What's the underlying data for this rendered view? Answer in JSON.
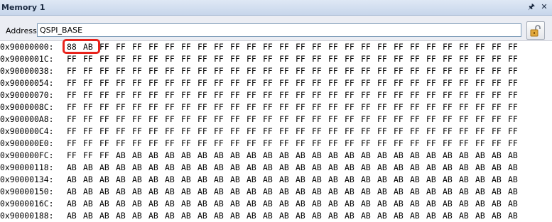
{
  "window": {
    "title": "Memory 1",
    "pin_icon": "pin-icon",
    "close_icon": "close-icon"
  },
  "toolbar": {
    "address_label": "Address:",
    "address_value": "QSPI_BASE",
    "lock_icon": "unlock-icon"
  },
  "memory": {
    "rows": [
      {
        "addr": "0x90000000:",
        "bytes": [
          "88",
          "AB",
          "FF",
          "FF",
          "FF",
          "FF",
          "FF",
          "FF",
          "FF",
          "FF",
          "FF",
          "FF",
          "FF",
          "FF",
          "FF",
          "FF",
          "FF",
          "FF",
          "FF",
          "FF",
          "FF",
          "FF",
          "FF",
          "FF",
          "FF",
          "FF",
          "FF",
          "FF"
        ]
      },
      {
        "addr": "0x9000001C:",
        "bytes": [
          "FF",
          "FF",
          "FF",
          "FF",
          "FF",
          "FF",
          "FF",
          "FF",
          "FF",
          "FF",
          "FF",
          "FF",
          "FF",
          "FF",
          "FF",
          "FF",
          "FF",
          "FF",
          "FF",
          "FF",
          "FF",
          "FF",
          "FF",
          "FF",
          "FF",
          "FF",
          "FF",
          "FF"
        ]
      },
      {
        "addr": "0x90000038:",
        "bytes": [
          "FF",
          "FF",
          "FF",
          "FF",
          "FF",
          "FF",
          "FF",
          "FF",
          "FF",
          "FF",
          "FF",
          "FF",
          "FF",
          "FF",
          "FF",
          "FF",
          "FF",
          "FF",
          "FF",
          "FF",
          "FF",
          "FF",
          "FF",
          "FF",
          "FF",
          "FF",
          "FF",
          "FF"
        ]
      },
      {
        "addr": "0x90000054:",
        "bytes": [
          "FF",
          "FF",
          "FF",
          "FF",
          "FF",
          "FF",
          "FF",
          "FF",
          "FF",
          "FF",
          "FF",
          "FF",
          "FF",
          "FF",
          "FF",
          "FF",
          "FF",
          "FF",
          "FF",
          "FF",
          "FF",
          "FF",
          "FF",
          "FF",
          "FF",
          "FF",
          "FF",
          "FF"
        ]
      },
      {
        "addr": "0x90000070:",
        "bytes": [
          "FF",
          "FF",
          "FF",
          "FF",
          "FF",
          "FF",
          "FF",
          "FF",
          "FF",
          "FF",
          "FF",
          "FF",
          "FF",
          "FF",
          "FF",
          "FF",
          "FF",
          "FF",
          "FF",
          "FF",
          "FF",
          "FF",
          "FF",
          "FF",
          "FF",
          "FF",
          "FF",
          "FF"
        ]
      },
      {
        "addr": "0x9000008C:",
        "bytes": [
          "FF",
          "FF",
          "FF",
          "FF",
          "FF",
          "FF",
          "FF",
          "FF",
          "FF",
          "FF",
          "FF",
          "FF",
          "FF",
          "FF",
          "FF",
          "FF",
          "FF",
          "FF",
          "FF",
          "FF",
          "FF",
          "FF",
          "FF",
          "FF",
          "FF",
          "FF",
          "FF",
          "FF"
        ]
      },
      {
        "addr": "0x900000A8:",
        "bytes": [
          "FF",
          "FF",
          "FF",
          "FF",
          "FF",
          "FF",
          "FF",
          "FF",
          "FF",
          "FF",
          "FF",
          "FF",
          "FF",
          "FF",
          "FF",
          "FF",
          "FF",
          "FF",
          "FF",
          "FF",
          "FF",
          "FF",
          "FF",
          "FF",
          "FF",
          "FF",
          "FF",
          "FF"
        ]
      },
      {
        "addr": "0x900000C4:",
        "bytes": [
          "FF",
          "FF",
          "FF",
          "FF",
          "FF",
          "FF",
          "FF",
          "FF",
          "FF",
          "FF",
          "FF",
          "FF",
          "FF",
          "FF",
          "FF",
          "FF",
          "FF",
          "FF",
          "FF",
          "FF",
          "FF",
          "FF",
          "FF",
          "FF",
          "FF",
          "FF",
          "FF",
          "FF"
        ]
      },
      {
        "addr": "0x900000E0:",
        "bytes": [
          "FF",
          "FF",
          "FF",
          "FF",
          "FF",
          "FF",
          "FF",
          "FF",
          "FF",
          "FF",
          "FF",
          "FF",
          "FF",
          "FF",
          "FF",
          "FF",
          "FF",
          "FF",
          "FF",
          "FF",
          "FF",
          "FF",
          "FF",
          "FF",
          "FF",
          "FF",
          "FF",
          "FF"
        ]
      },
      {
        "addr": "0x900000FC:",
        "bytes": [
          "FF",
          "FF",
          "FF",
          "AB",
          "AB",
          "AB",
          "AB",
          "AB",
          "AB",
          "AB",
          "AB",
          "AB",
          "AB",
          "AB",
          "AB",
          "AB",
          "AB",
          "AB",
          "AB",
          "AB",
          "AB",
          "AB",
          "AB",
          "AB",
          "AB",
          "AB",
          "AB",
          "AB"
        ]
      },
      {
        "addr": "0x90000118:",
        "bytes": [
          "AB",
          "AB",
          "AB",
          "AB",
          "AB",
          "AB",
          "AB",
          "AB",
          "AB",
          "AB",
          "AB",
          "AB",
          "AB",
          "AB",
          "AB",
          "AB",
          "AB",
          "AB",
          "AB",
          "AB",
          "AB",
          "AB",
          "AB",
          "AB",
          "AB",
          "AB",
          "AB",
          "AB"
        ]
      },
      {
        "addr": "0x90000134:",
        "bytes": [
          "AB",
          "AB",
          "AB",
          "AB",
          "AB",
          "AB",
          "AB",
          "AB",
          "AB",
          "AB",
          "AB",
          "AB",
          "AB",
          "AB",
          "AB",
          "AB",
          "AB",
          "AB",
          "AB",
          "AB",
          "AB",
          "AB",
          "AB",
          "AB",
          "AB",
          "AB",
          "AB",
          "AB"
        ]
      },
      {
        "addr": "0x90000150:",
        "bytes": [
          "AB",
          "AB",
          "AB",
          "AB",
          "AB",
          "AB",
          "AB",
          "AB",
          "AB",
          "AB",
          "AB",
          "AB",
          "AB",
          "AB",
          "AB",
          "AB",
          "AB",
          "AB",
          "AB",
          "AB",
          "AB",
          "AB",
          "AB",
          "AB",
          "AB",
          "AB",
          "AB",
          "AB"
        ]
      },
      {
        "addr": "0x9000016C:",
        "bytes": [
          "AB",
          "AB",
          "AB",
          "AB",
          "AB",
          "AB",
          "AB",
          "AB",
          "AB",
          "AB",
          "AB",
          "AB",
          "AB",
          "AB",
          "AB",
          "AB",
          "AB",
          "AB",
          "AB",
          "AB",
          "AB",
          "AB",
          "AB",
          "AB",
          "AB",
          "AB",
          "AB",
          "AB"
        ]
      },
      {
        "addr": "0x90000188:",
        "bytes": [
          "AB",
          "AB",
          "AB",
          "AB",
          "AB",
          "AB",
          "AB",
          "AB",
          "AB",
          "AB",
          "AB",
          "AB",
          "AB",
          "AB",
          "AB",
          "AB",
          "AB",
          "AB",
          "AB",
          "AB",
          "AB",
          "AB",
          "AB",
          "AB",
          "AB",
          "AB",
          "AB",
          "AB"
        ]
      }
    ],
    "highlight_color": "#e8231c"
  }
}
